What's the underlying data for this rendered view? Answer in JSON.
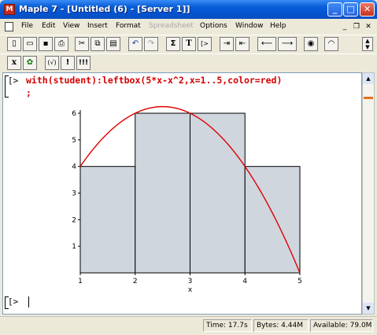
{
  "window": {
    "title": "Maple 7 - [Untitled (6) - [Server 1]]",
    "app_icon_glyph": "M"
  },
  "menu": [
    "File",
    "Edit",
    "View",
    "Insert",
    "Format",
    "Spreadsheet",
    "Options",
    "Window",
    "Help"
  ],
  "menu_disabled": [
    "Spreadsheet"
  ],
  "toolbar1_icons": [
    "new-icon",
    "open-icon",
    "save-icon",
    "print-icon",
    "cut-icon",
    "copy-icon",
    "paste-icon",
    "undo-icon",
    "redo-icon",
    "sigma-icon",
    "text-icon",
    "insert-prompt-icon",
    "indent-icon",
    "outdent-icon",
    "back-icon",
    "forward-icon",
    "stop-icon",
    "help-icon"
  ],
  "toolbar2_icons": [
    "math-x-icon",
    "maple-leaf-icon",
    "group-icon",
    "execute-icon",
    "execute-all-icon"
  ],
  "toolbar1_glyphs": {
    "sigma": "Σ",
    "text": "T",
    "insert": "[>",
    "undo": "↶",
    "redo": "↷"
  },
  "toolbar2_glyphs": {
    "x": "x",
    "paren": "(√)",
    "exclaim": "!",
    "triple": "!!!"
  },
  "worksheet": {
    "prompt1": "[>",
    "command_line1": "with(student):leftbox(5*x-x^2,x=1..5,color=red)",
    "command_line2": ";",
    "prompt2": "[>"
  },
  "chart_data": {
    "type": "bar",
    "description": "left Riemann sum boxes with curve 5*x-x^2",
    "xlim": [
      1,
      5
    ],
    "ylim": [
      0,
      6
    ],
    "x_ticks": [
      "1",
      "2",
      "3",
      "4",
      "5"
    ],
    "y_ticks": [
      "1",
      "2",
      "3",
      "4",
      "5",
      "6"
    ],
    "xlabel": "x",
    "boxes": [
      {
        "x0": 1,
        "x1": 2,
        "height": 4
      },
      {
        "x0": 2,
        "x1": 3,
        "height": 6
      },
      {
        "x0": 3,
        "x1": 4,
        "height": 6
      },
      {
        "x0": 4,
        "x1": 5,
        "height": 4
      }
    ],
    "box_fill": "#cfd6de",
    "curve_color": "#e00000",
    "curve": "5*x-x^2"
  },
  "status": {
    "time": "Time: 17.7s",
    "bytes": "Bytes: 4.44M",
    "available": "Available: 79.0M"
  },
  "colors": {
    "titlebar": "#0453d1",
    "command_text": "#d40000"
  }
}
